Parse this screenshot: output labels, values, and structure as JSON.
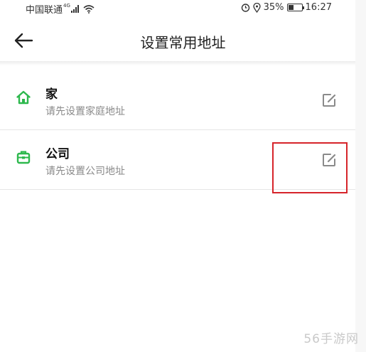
{
  "status_bar": {
    "carrier": "中国联通",
    "network": "4G",
    "battery_percent": "35%",
    "time": "16:27"
  },
  "header": {
    "title": "设置常用地址"
  },
  "addresses": [
    {
      "name": "家",
      "hint": "请先设置家庭地址",
      "icon": "home-icon"
    },
    {
      "name": "公司",
      "hint": "请先设置公司地址",
      "icon": "briefcase-icon"
    }
  ],
  "colors": {
    "accent": "#2db84d",
    "highlight": "#d6242a"
  },
  "watermark": "56手游网"
}
